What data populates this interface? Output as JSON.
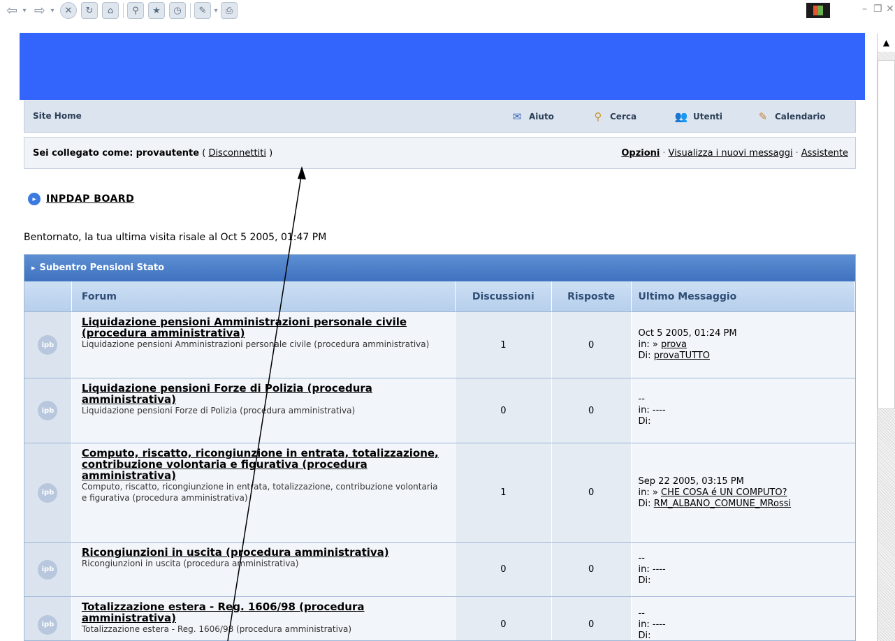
{
  "toolbar": {
    "icons": [
      "back-icon",
      "forward-icon",
      "stop-icon",
      "refresh-icon",
      "home-icon",
      "search-icon",
      "favorites-icon",
      "history-icon",
      "edit-icon",
      "print-icon"
    ]
  },
  "nav": {
    "home": "Site Home",
    "items": [
      "Aiuto",
      "Cerca",
      "Utenti",
      "Calendario"
    ]
  },
  "user": {
    "prefix": "Sei collegato come:",
    "username": "provautente",
    "logout": "Disconnettiti",
    "links": [
      "Opzioni",
      "Visualizza i nuovi messaggi",
      "Assistente"
    ]
  },
  "board": {
    "title": "INPDAP BOARD"
  },
  "welcome": "Bentornato, la tua ultima visita risale al Oct 5 2005, 01:47 PM",
  "category": "Subentro Pensioni Stato",
  "table": {
    "headers": [
      "Forum",
      "Discussioni",
      "Risposte",
      "Ultimo Messaggio"
    ],
    "rows": [
      {
        "title": "Liquidazione pensioni Amministrazioni personale civile (procedura amministrativa)",
        "desc": "Liquidazione pensioni Amministrazioni personale civile (procedura amministrativa)",
        "topics": "1",
        "replies": "0",
        "last_date": "Oct 5 2005, 01:24 PM",
        "last_in": "prova",
        "last_by": "provaTUTTO"
      },
      {
        "title": "Liquidazione pensioni Forze di Polizia (procedura amministrativa)",
        "desc": "Liquidazione pensioni Forze di Polizia (procedura amministrativa)",
        "topics": "0",
        "replies": "0",
        "last_date": "--",
        "last_in": "----",
        "last_by": ""
      },
      {
        "title": "Computo, riscatto, ricongiunzione in entrata, totalizzazione, contribuzione volontaria e figurativa (procedura amministrativa)",
        "desc": "Computo, riscatto, ricongiunzione in entrata, totalizzazione, contribuzione volontaria e figurativa (procedura amministrativa)",
        "topics": "1",
        "replies": "0",
        "last_date": "Sep 22 2005, 03:15 PM",
        "last_in": "CHE COSA é UN COMPUTO?",
        "last_by": "RM_ALBANO_COMUNE_MRossi"
      },
      {
        "title": "Ricongiunzioni in uscita (procedura amministrativa)",
        "desc": "Ricongiunzioni in uscita (procedura amministrativa)",
        "topics": "0",
        "replies": "0",
        "last_date": "--",
        "last_in": "----",
        "last_by": ""
      },
      {
        "title": "Totalizzazione estera - Reg. 1606/98 (procedura amministrativa)",
        "desc": "Totalizzazione estera - Reg. 1606/98 (procedura amministrativa)",
        "topics": "0",
        "replies": "0",
        "last_date": "--",
        "last_in": "----",
        "last_by": ""
      }
    ],
    "labels": {
      "in": "in:",
      "by": "Di:"
    }
  },
  "colors": {
    "banner": "#3364fb",
    "category": "#4a7fc8",
    "annotation_arrow": "#000000"
  }
}
